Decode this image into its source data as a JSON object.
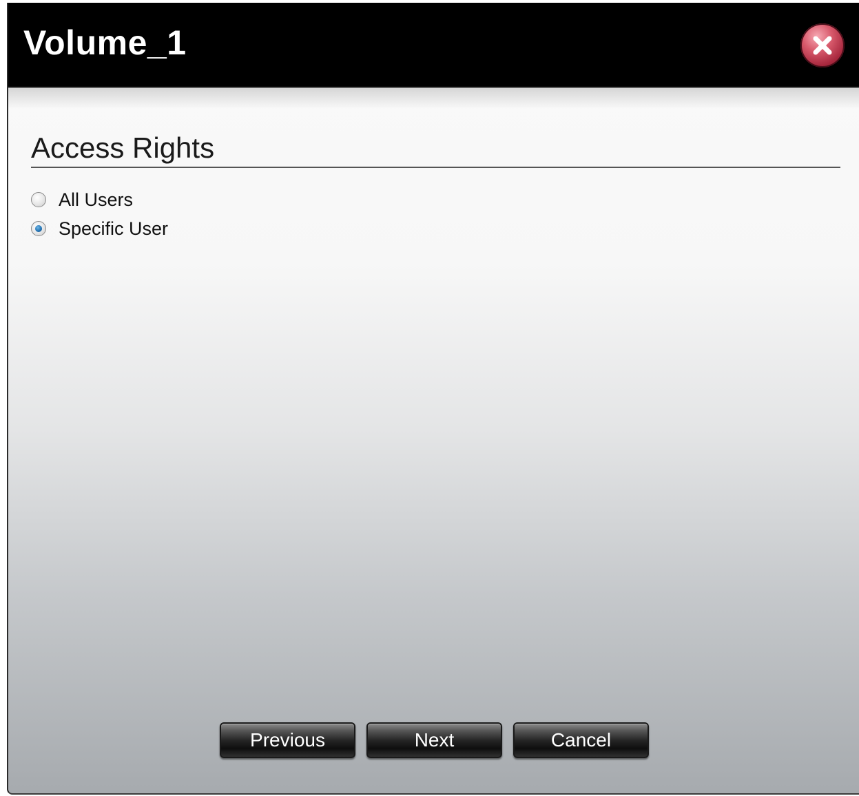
{
  "window": {
    "title": "Volume_1"
  },
  "section": {
    "title": "Access Rights"
  },
  "access_options": [
    {
      "label": "All Users",
      "selected": false
    },
    {
      "label": "Specific User",
      "selected": true
    }
  ],
  "buttons": {
    "previous": "Previous",
    "next": "Next",
    "cancel": "Cancel"
  },
  "icons": {
    "close": "close-icon",
    "radio": "radio-icon"
  },
  "colors": {
    "titlebar": "#000000",
    "close_button": "#c2374d",
    "radio_selected": "#1f6fb0"
  }
}
